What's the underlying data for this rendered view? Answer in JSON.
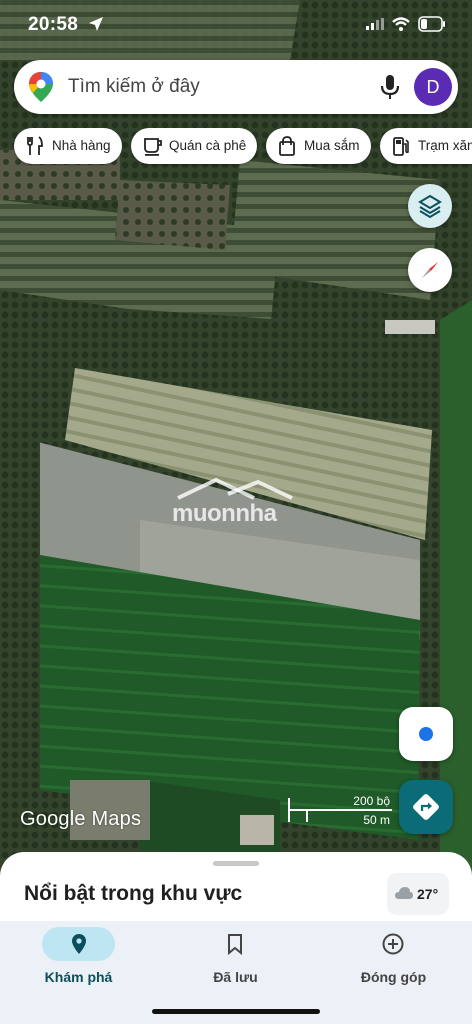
{
  "status_bar": {
    "time": "20:58"
  },
  "search": {
    "placeholder": "Tìm kiếm ở đây",
    "avatar_letter": "D"
  },
  "chips": [
    {
      "label": "Nhà hàng",
      "icon": "fork-knife-icon"
    },
    {
      "label": "Quán cà phê",
      "icon": "coffee-cup-icon"
    },
    {
      "label": "Mua sắm",
      "icon": "shopping-bag-icon"
    },
    {
      "label": "Trạm xăng",
      "icon": "gas-pump-icon"
    }
  ],
  "map": {
    "attribution": "Google Maps",
    "scale_top": "200 bộ",
    "scale_bottom": "50 m",
    "watermark": "muonnha"
  },
  "sheet": {
    "title": "Nổi bật trong khu vực",
    "weather_temp": "27°"
  },
  "tabs": [
    {
      "label": "Khám phá",
      "icon": "explore-pin-icon",
      "active": true
    },
    {
      "label": "Đã lưu",
      "icon": "bookmark-icon",
      "active": false
    },
    {
      "label": "Đóng góp",
      "icon": "add-circle-icon",
      "active": false
    }
  ],
  "colors": {
    "accent": "#0b6c78",
    "avatar": "#5b2bb3",
    "location_dot": "#1a73e8",
    "tab_pill": "#bde6f2"
  }
}
